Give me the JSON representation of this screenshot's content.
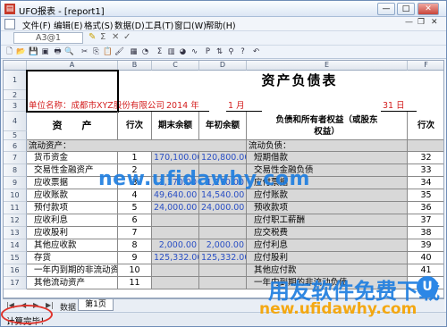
{
  "window": {
    "title": "UFO报表 - [report1]",
    "app_icon": "ufo-app-icon",
    "controls": [
      "—",
      "□",
      "✕"
    ]
  },
  "menu": {
    "items": [
      "文件(F)",
      "编辑(E)",
      "格式(S)",
      "数据(D)",
      "工具(T)",
      "窗口(W)",
      "帮助(H)"
    ],
    "mdi_controls": [
      "—",
      "❐",
      "✕"
    ]
  },
  "formula_bar": {
    "cell_ref": "A3@1",
    "fx_icons": [
      "✎",
      "Σ",
      "✕",
      "✓"
    ]
  },
  "toolbar": {
    "icons": [
      "new-icon",
      "open-icon",
      "save-icon",
      "save-as-icon",
      "print-icon",
      "preview-icon",
      "cut-icon",
      "copy-icon",
      "paste-icon",
      "format-painter-icon",
      "table-icon",
      "chart-icon",
      "sum-icon",
      "bar-chart-icon",
      "pie-chart-icon",
      "line-chart-icon",
      "p-icon",
      "sort-icon",
      "filter-icon",
      "help-icon",
      "undo-icon"
    ],
    "glyphs": [
      "🗋",
      "📂",
      "💾",
      "▣",
      "🖶",
      "🔍",
      "✂",
      "⎘",
      "📋",
      "🖌",
      "▦",
      "◔",
      "Σ",
      "▥",
      "◕",
      "∿",
      "P",
      "⇅",
      "⚲",
      "?",
      "↶"
    ]
  },
  "sheet": {
    "columns": [
      "A",
      "B",
      "C",
      "D",
      "E",
      "F"
    ],
    "rows": [
      {
        "n": "1",
        "cells": [
          {
            "c": "",
            "col": "A"
          },
          {
            "c": "资产负债表",
            "col": "title"
          }
        ]
      },
      {
        "n": "2",
        "cells": []
      },
      {
        "n": "3",
        "cells": [
          {
            "c": "单位名称：成都市XYZ股份有限公司",
            "col": "A"
          },
          {
            "c": "2014 年",
            "col": "C"
          },
          {
            "c": "1 月",
            "col": "D"
          },
          {
            "c": "31 日",
            "col": "E"
          }
        ]
      },
      {
        "n": "4",
        "cells": [
          {
            "c": "资　　产",
            "col": "A"
          },
          {
            "c": "行次",
            "col": "B"
          },
          {
            "c": "期末余额",
            "col": "C"
          },
          {
            "c": "年初余额",
            "col": "D"
          },
          {
            "c": "负债和所有者权益（或股东权益）",
            "col": "E"
          },
          {
            "c": "行次",
            "col": "F"
          }
        ]
      },
      {
        "n": "5",
        "cells": []
      },
      {
        "n": "6",
        "cells": [
          {
            "c": "流动资产：",
            "col": "A"
          },
          {
            "c": "流动负债：",
            "col": "E"
          }
        ]
      },
      {
        "n": "7",
        "cells": [
          {
            "c": "货币资金",
            "col": "A"
          },
          {
            "c": "1",
            "col": "B"
          },
          {
            "c": "170,100.00",
            "col": "C"
          },
          {
            "c": "120,800.00",
            "col": "D"
          },
          {
            "c": "短期借款",
            "col": "E"
          },
          {
            "c": "32",
            "col": "F"
          }
        ]
      },
      {
        "n": "8",
        "cells": [
          {
            "c": "交易性金融资产",
            "col": "A"
          },
          {
            "c": "2",
            "col": "B"
          },
          {
            "c": "",
            "col": "C"
          },
          {
            "c": "",
            "col": "D"
          },
          {
            "c": "交易性金融负债",
            "col": "E"
          },
          {
            "c": "33",
            "col": "F"
          }
        ]
      },
      {
        "n": "9",
        "cells": [
          {
            "c": "应收票据",
            "col": "A"
          },
          {
            "c": "3",
            "col": "B"
          },
          {
            "c": "1,170.00",
            "col": "C"
          },
          {
            "c": "1,170.00",
            "col": "D"
          },
          {
            "c": "应付票据",
            "col": "E"
          },
          {
            "c": "34",
            "col": "F"
          }
        ]
      },
      {
        "n": "10",
        "cells": [
          {
            "c": "应收账款",
            "col": "A"
          },
          {
            "c": "4",
            "col": "B"
          },
          {
            "c": "49,640.00",
            "col": "C"
          },
          {
            "c": "14,540.00",
            "col": "D"
          },
          {
            "c": "应付账款",
            "col": "E"
          },
          {
            "c": "35",
            "col": "F"
          }
        ]
      },
      {
        "n": "11",
        "cells": [
          {
            "c": "预付款项",
            "col": "A"
          },
          {
            "c": "5",
            "col": "B"
          },
          {
            "c": "24,000.00",
            "col": "C"
          },
          {
            "c": "24,000.00",
            "col": "D"
          },
          {
            "c": "预收款项",
            "col": "E"
          },
          {
            "c": "36",
            "col": "F"
          }
        ]
      },
      {
        "n": "12",
        "cells": [
          {
            "c": "应收利息",
            "col": "A"
          },
          {
            "c": "6",
            "col": "B"
          },
          {
            "c": "",
            "col": "C"
          },
          {
            "c": "",
            "col": "D"
          },
          {
            "c": "应付职工薪酬",
            "col": "E"
          },
          {
            "c": "37",
            "col": "F"
          }
        ]
      },
      {
        "n": "13",
        "cells": [
          {
            "c": "应收股利",
            "col": "A"
          },
          {
            "c": "7",
            "col": "B"
          },
          {
            "c": "",
            "col": "C"
          },
          {
            "c": "",
            "col": "D"
          },
          {
            "c": "应交税费",
            "col": "E"
          },
          {
            "c": "38",
            "col": "F"
          }
        ]
      },
      {
        "n": "14",
        "cells": [
          {
            "c": "其他应收款",
            "col": "A"
          },
          {
            "c": "8",
            "col": "B"
          },
          {
            "c": "2,000.00",
            "col": "C"
          },
          {
            "c": "2,000.00",
            "col": "D"
          },
          {
            "c": "应付利息",
            "col": "E"
          },
          {
            "c": "39",
            "col": "F"
          }
        ]
      },
      {
        "n": "15",
        "cells": [
          {
            "c": "存货",
            "col": "A"
          },
          {
            "c": "9",
            "col": "B"
          },
          {
            "c": "125,332.00",
            "col": "C"
          },
          {
            "c": "125,332.00",
            "col": "D"
          },
          {
            "c": "应付股利",
            "col": "E"
          },
          {
            "c": "40",
            "col": "F"
          }
        ]
      },
      {
        "n": "16",
        "cells": [
          {
            "c": "一年内到期的非流动资产",
            "col": "A"
          },
          {
            "c": "10",
            "col": "B"
          },
          {
            "c": "",
            "col": "C"
          },
          {
            "c": "",
            "col": "D"
          },
          {
            "c": "其他应付款",
            "col": "E"
          },
          {
            "c": "41",
            "col": "F"
          }
        ]
      },
      {
        "n": "17",
        "cells": [
          {
            "c": "其他流动资产",
            "col": "A"
          },
          {
            "c": "11",
            "col": "B"
          },
          {
            "c": "",
            "col": "C"
          },
          {
            "c": "",
            "col": "D"
          },
          {
            "c": "一年内到期的非流动负债",
            "col": "E"
          },
          {
            "c": "42",
            "col": "F"
          }
        ]
      }
    ]
  },
  "sheet_tabs": {
    "nav": [
      "|◀",
      "◀",
      "▶",
      "▶|"
    ],
    "first_cut": "数据",
    "active": "第1页"
  },
  "status": {
    "text": "计算完毕！"
  },
  "watermarks": {
    "url1": "new.ufidawhy.com",
    "brand": "用友软件免费下载",
    "url2": "new.ufidawhy.com",
    "logo": "U"
  },
  "colors": {
    "blue": "#2a4fc4",
    "red": "#d42020",
    "grey": "#d8d8d8",
    "watermark": "#1f7ee0"
  }
}
